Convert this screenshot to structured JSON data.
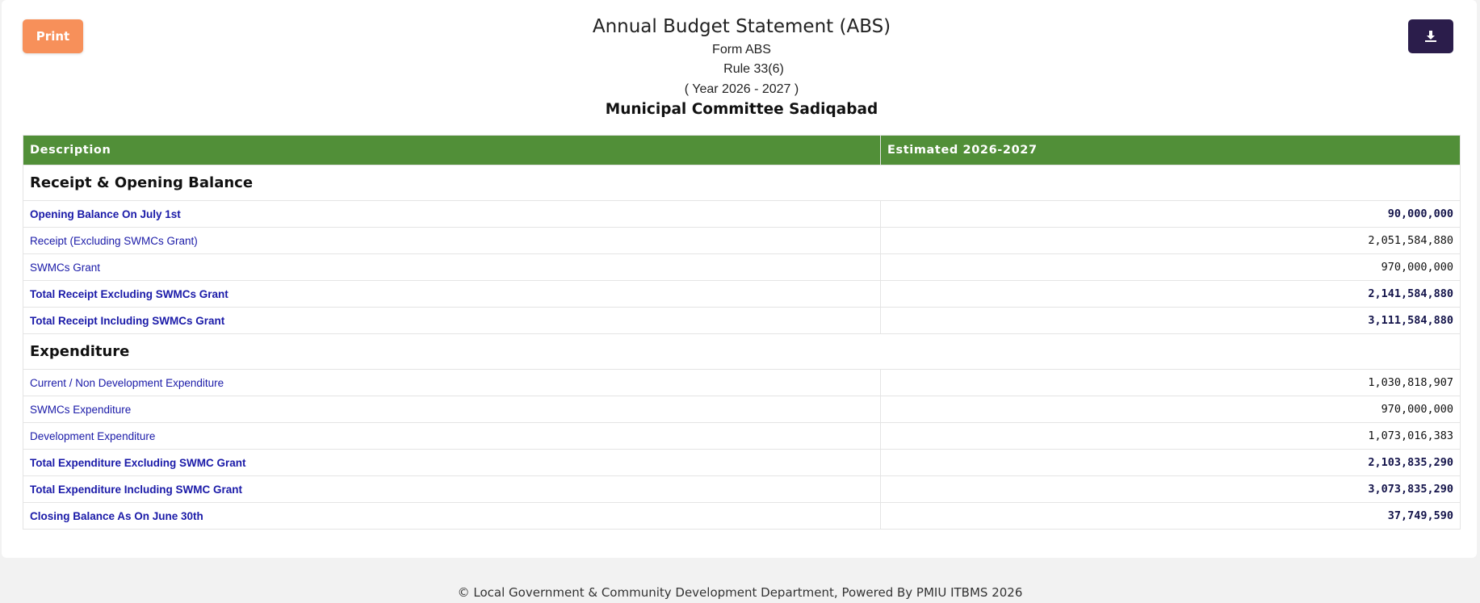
{
  "toolbar": {
    "print_label": "Print",
    "download_icon": "download-icon"
  },
  "header": {
    "title": "Annual Budget Statement (ABS)",
    "form": "Form ABS",
    "rule": "Rule 33(6)",
    "year": "( Year 2026 - 2027 )",
    "committee": "Municipal Committee Sadiqabad"
  },
  "table": {
    "columns": [
      "Description",
      "Estimated 2026-2027"
    ],
    "sections": [
      {
        "title": "Receipt & Opening Balance",
        "rows": [
          {
            "label": "Opening Balance On July 1st",
            "value": "90,000,000",
            "bold": true
          },
          {
            "label": "Receipt (Excluding SWMCs Grant)",
            "value": "2,051,584,880",
            "bold": false
          },
          {
            "label": "SWMCs Grant",
            "value": "970,000,000",
            "bold": false
          },
          {
            "label": "Total Receipt Excluding SWMCs Grant",
            "value": "2,141,584,880",
            "bold": true
          },
          {
            "label": "Total Receipt Including SWMCs Grant",
            "value": "3,111,584,880",
            "bold": true
          }
        ]
      },
      {
        "title": "Expenditure",
        "rows": [
          {
            "label": "Current / Non Development Expenditure",
            "value": "1,030,818,907",
            "bold": false
          },
          {
            "label": "SWMCs Expenditure",
            "value": "970,000,000",
            "bold": false
          },
          {
            "label": "Development Expenditure",
            "value": "1,073,016,383",
            "bold": false
          },
          {
            "label": "Total Expenditure Excluding SWMC Grant",
            "value": "2,103,835,290",
            "bold": true
          },
          {
            "label": "Total Expenditure Including SWMC Grant",
            "value": "3,073,835,290",
            "bold": true
          },
          {
            "label": "Closing Balance As On June 30th",
            "value": "37,749,590",
            "bold": true
          }
        ]
      }
    ]
  },
  "footer": {
    "text": "© Local Government & Community Development Department, Powered By PMIU ITBMS 2026"
  },
  "colors": {
    "header_green": "#518f38",
    "print_orange": "#f7905a",
    "download_purple": "#2b1d4b",
    "label_blue": "#1a1aa8"
  }
}
